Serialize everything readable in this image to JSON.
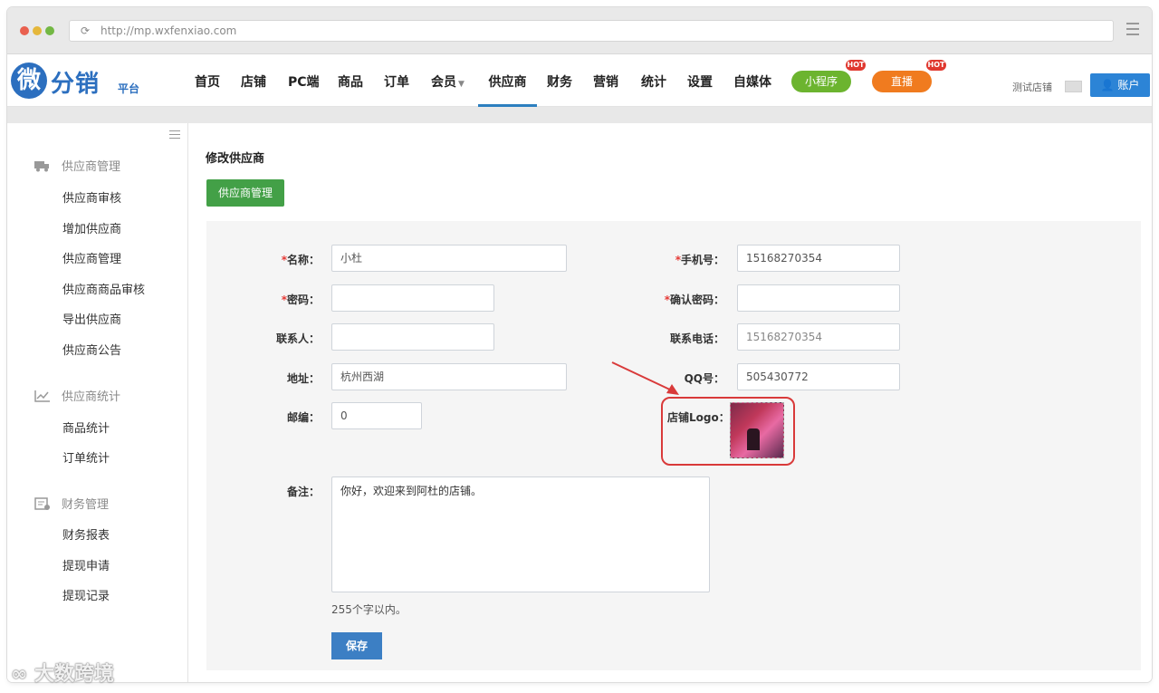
{
  "browser": {
    "url": "http://mp.wxfenxiao.com"
  },
  "brand": {
    "logo_char": "微",
    "logo_text": "分销",
    "logo_sub": "平台"
  },
  "nav": {
    "items": [
      "首页",
      "店铺",
      "PC端",
      "商品",
      "订单",
      "会员",
      "供应商",
      "财务",
      "营销",
      "统计",
      "设置",
      "自媒体"
    ],
    "active": "供应商",
    "mini_program": "小程序",
    "live": "直播",
    "hot_badge": "HOT",
    "store_name": "测试店铺",
    "account": "账户"
  },
  "sidebar": {
    "sections": [
      {
        "title": "供应商管理",
        "icon": "truck-icon",
        "items": [
          "供应商审核",
          "增加供应商",
          "供应商管理",
          "供应商商品审核",
          "导出供应商",
          "供应商公告"
        ]
      },
      {
        "title": "供应商统计",
        "icon": "chart-icon",
        "items": [
          "商品统计",
          "订单统计"
        ]
      },
      {
        "title": "财务管理",
        "icon": "finance-icon",
        "items": [
          "财务报表",
          "提现申请",
          "提现记录"
        ]
      }
    ]
  },
  "page": {
    "title": "修改供应商",
    "back_button": "供应商管理"
  },
  "form": {
    "name_label": "名称：",
    "name_value": "小杜",
    "phone_label": "手机号：",
    "phone_value": "15168270354",
    "password_label": "密码：",
    "password_value": "",
    "confirm_label": "确认密码：",
    "confirm_value": "",
    "contact_label": "联系人：",
    "contact_value": "",
    "tel_label": "联系电话：",
    "tel_value": "15168270354",
    "address_label": "地址：",
    "address_value": "杭州西湖",
    "qq_label": "QQ号：",
    "qq_value": "505430772",
    "zip_label": "邮编：",
    "zip_value": "0",
    "logo_label": "店铺Logo：",
    "remark_label": "备注：",
    "remark_value": "你好，欢迎来到阿杜的店铺。",
    "remark_hint": "255个字以内。",
    "required_mark": "*",
    "save": "保存"
  },
  "watermark": "大数跨境",
  "colors": {
    "accent": "#2c84d6",
    "green": "#43a047",
    "highlight": "#d93a3a"
  }
}
